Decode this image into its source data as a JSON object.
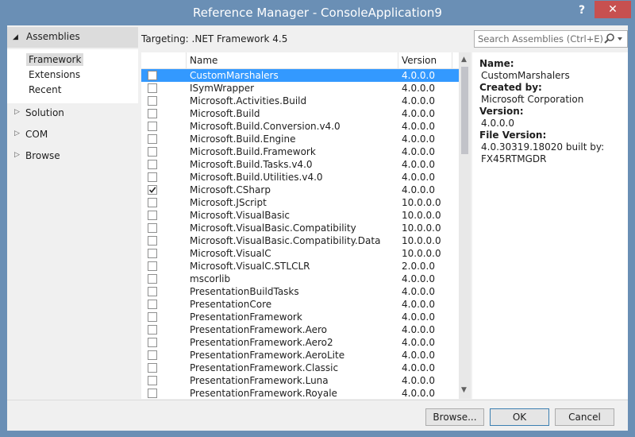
{
  "window": {
    "title": "Reference Manager - ConsoleApplication9",
    "help": "?",
    "close": "✕"
  },
  "nav": {
    "group": {
      "label": "Assemblies",
      "arrow": "◢"
    },
    "subitems": [
      "Framework",
      "Extensions",
      "Recent"
    ],
    "selected_subitem": "Framework",
    "items": [
      "Solution",
      "COM",
      "Browse"
    ],
    "collapsed_arrow": "▷"
  },
  "targeting": "Targeting: .NET Framework 4.5",
  "search": {
    "placeholder": "Search Assemblies (Ctrl+E)"
  },
  "table": {
    "columns": {
      "name": "Name",
      "version": "Version"
    },
    "rows": [
      {
        "name": "CustomMarshalers",
        "version": "4.0.0.0",
        "checked": false,
        "selected": true
      },
      {
        "name": "ISymWrapper",
        "version": "4.0.0.0",
        "checked": false,
        "selected": false
      },
      {
        "name": "Microsoft.Activities.Build",
        "version": "4.0.0.0",
        "checked": false,
        "selected": false
      },
      {
        "name": "Microsoft.Build",
        "version": "4.0.0.0",
        "checked": false,
        "selected": false
      },
      {
        "name": "Microsoft.Build.Conversion.v4.0",
        "version": "4.0.0.0",
        "checked": false,
        "selected": false
      },
      {
        "name": "Microsoft.Build.Engine",
        "version": "4.0.0.0",
        "checked": false,
        "selected": false
      },
      {
        "name": "Microsoft.Build.Framework",
        "version": "4.0.0.0",
        "checked": false,
        "selected": false
      },
      {
        "name": "Microsoft.Build.Tasks.v4.0",
        "version": "4.0.0.0",
        "checked": false,
        "selected": false
      },
      {
        "name": "Microsoft.Build.Utilities.v4.0",
        "version": "4.0.0.0",
        "checked": false,
        "selected": false
      },
      {
        "name": "Microsoft.CSharp",
        "version": "4.0.0.0",
        "checked": true,
        "selected": false
      },
      {
        "name": "Microsoft.JScript",
        "version": "10.0.0.0",
        "checked": false,
        "selected": false
      },
      {
        "name": "Microsoft.VisualBasic",
        "version": "10.0.0.0",
        "checked": false,
        "selected": false
      },
      {
        "name": "Microsoft.VisualBasic.Compatibility",
        "version": "10.0.0.0",
        "checked": false,
        "selected": false
      },
      {
        "name": "Microsoft.VisualBasic.Compatibility.Data",
        "version": "10.0.0.0",
        "checked": false,
        "selected": false
      },
      {
        "name": "Microsoft.VisualC",
        "version": "10.0.0.0",
        "checked": false,
        "selected": false
      },
      {
        "name": "Microsoft.VisualC.STLCLR",
        "version": "2.0.0.0",
        "checked": false,
        "selected": false
      },
      {
        "name": "mscorlib",
        "version": "4.0.0.0",
        "checked": false,
        "selected": false
      },
      {
        "name": "PresentationBuildTasks",
        "version": "4.0.0.0",
        "checked": false,
        "selected": false
      },
      {
        "name": "PresentationCore",
        "version": "4.0.0.0",
        "checked": false,
        "selected": false
      },
      {
        "name": "PresentationFramework",
        "version": "4.0.0.0",
        "checked": false,
        "selected": false
      },
      {
        "name": "PresentationFramework.Aero",
        "version": "4.0.0.0",
        "checked": false,
        "selected": false
      },
      {
        "name": "PresentationFramework.Aero2",
        "version": "4.0.0.0",
        "checked": false,
        "selected": false
      },
      {
        "name": "PresentationFramework.AeroLite",
        "version": "4.0.0.0",
        "checked": false,
        "selected": false
      },
      {
        "name": "PresentationFramework.Classic",
        "version": "4.0.0.0",
        "checked": false,
        "selected": false
      },
      {
        "name": "PresentationFramework.Luna",
        "version": "4.0.0.0",
        "checked": false,
        "selected": false
      },
      {
        "name": "PresentationFramework.Royale",
        "version": "4.0.0.0",
        "checked": false,
        "selected": false
      }
    ]
  },
  "details": {
    "name_label": "Name:",
    "name_value": "CustomMarshalers",
    "createdby_label": "Created by:",
    "createdby_value": "Microsoft Corporation",
    "version_label": "Version:",
    "version_value": "4.0.0.0",
    "fileversion_label": "File Version:",
    "fileversion_value": "4.0.30319.18020 built by: FX45RTMGDR"
  },
  "buttons": {
    "browse": "Browse...",
    "ok": "OK",
    "cancel": "Cancel"
  },
  "colors": {
    "titlebar": "#6a8fb5",
    "selection": "#3399ff",
    "close": "#c75050"
  },
  "icons": {
    "search": "search-icon",
    "dropdown": "chevron-down-icon"
  }
}
